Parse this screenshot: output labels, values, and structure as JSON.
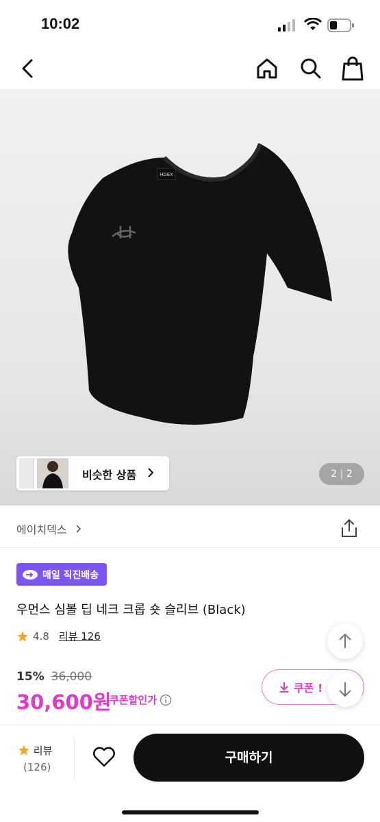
{
  "status_bar": {
    "time": "10:02"
  },
  "nav": {
    "back_icon": "chevron-left-icon",
    "home_icon": "home-icon",
    "search_icon": "search-icon",
    "bag_icon": "shopping-bag-icon"
  },
  "hero": {
    "shirt_tag": "HDEX",
    "similar_label": "비슷한 상품",
    "pager_current": "2",
    "pager_total": "2"
  },
  "brand": {
    "name": "에이치덱스"
  },
  "product": {
    "delivery_badge": "매일 직진배송",
    "title": "우먼스 심볼 딥 네크 크롭 숏 슬리브 (Black)",
    "rating": "4.8",
    "review_label": "리뷰 126",
    "discount_pct": "15%",
    "original_price": "36,000",
    "price": "30,600원",
    "coupon_note": "쿠폰할인가",
    "coupon_button": "쿠폰 !"
  },
  "bottom_bar": {
    "review_label": "리뷰",
    "review_count": "(126)",
    "buy_label": "구매하기"
  },
  "colors": {
    "accent": "#e338c9",
    "delivery": "#7e55f5",
    "buy": "#111111"
  }
}
